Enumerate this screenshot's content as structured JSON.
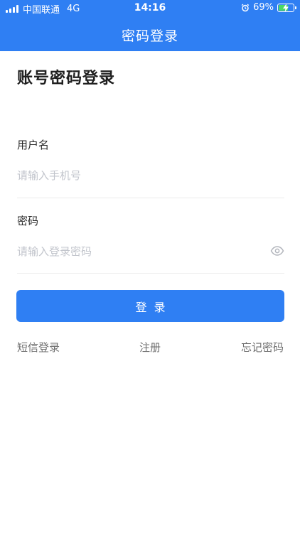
{
  "status_bar": {
    "carrier": "中国联通",
    "network": "4G",
    "time": "14:16",
    "battery": "69%",
    "battery_level": 0.69
  },
  "header": {
    "title": "密码登录"
  },
  "main": {
    "page_title": "账号密码登录",
    "username": {
      "label": "用户名",
      "placeholder": "请输入手机号",
      "value": ""
    },
    "password": {
      "label": "密码",
      "placeholder": "请输入登录密码",
      "value": ""
    },
    "login_button": "登录",
    "links": {
      "sms_login": "短信登录",
      "register": "注册",
      "forgot_password": "忘记密码"
    }
  },
  "icons": {
    "signal": "signal-bars-icon",
    "alarm": "alarm-icon",
    "battery": "battery-icon",
    "eye": "eye-icon"
  },
  "colors": {
    "primary": "#2f7ff3",
    "battery_fill": "#4cd964",
    "placeholder": "#c2c5cc",
    "link": "#6e6e6e"
  }
}
